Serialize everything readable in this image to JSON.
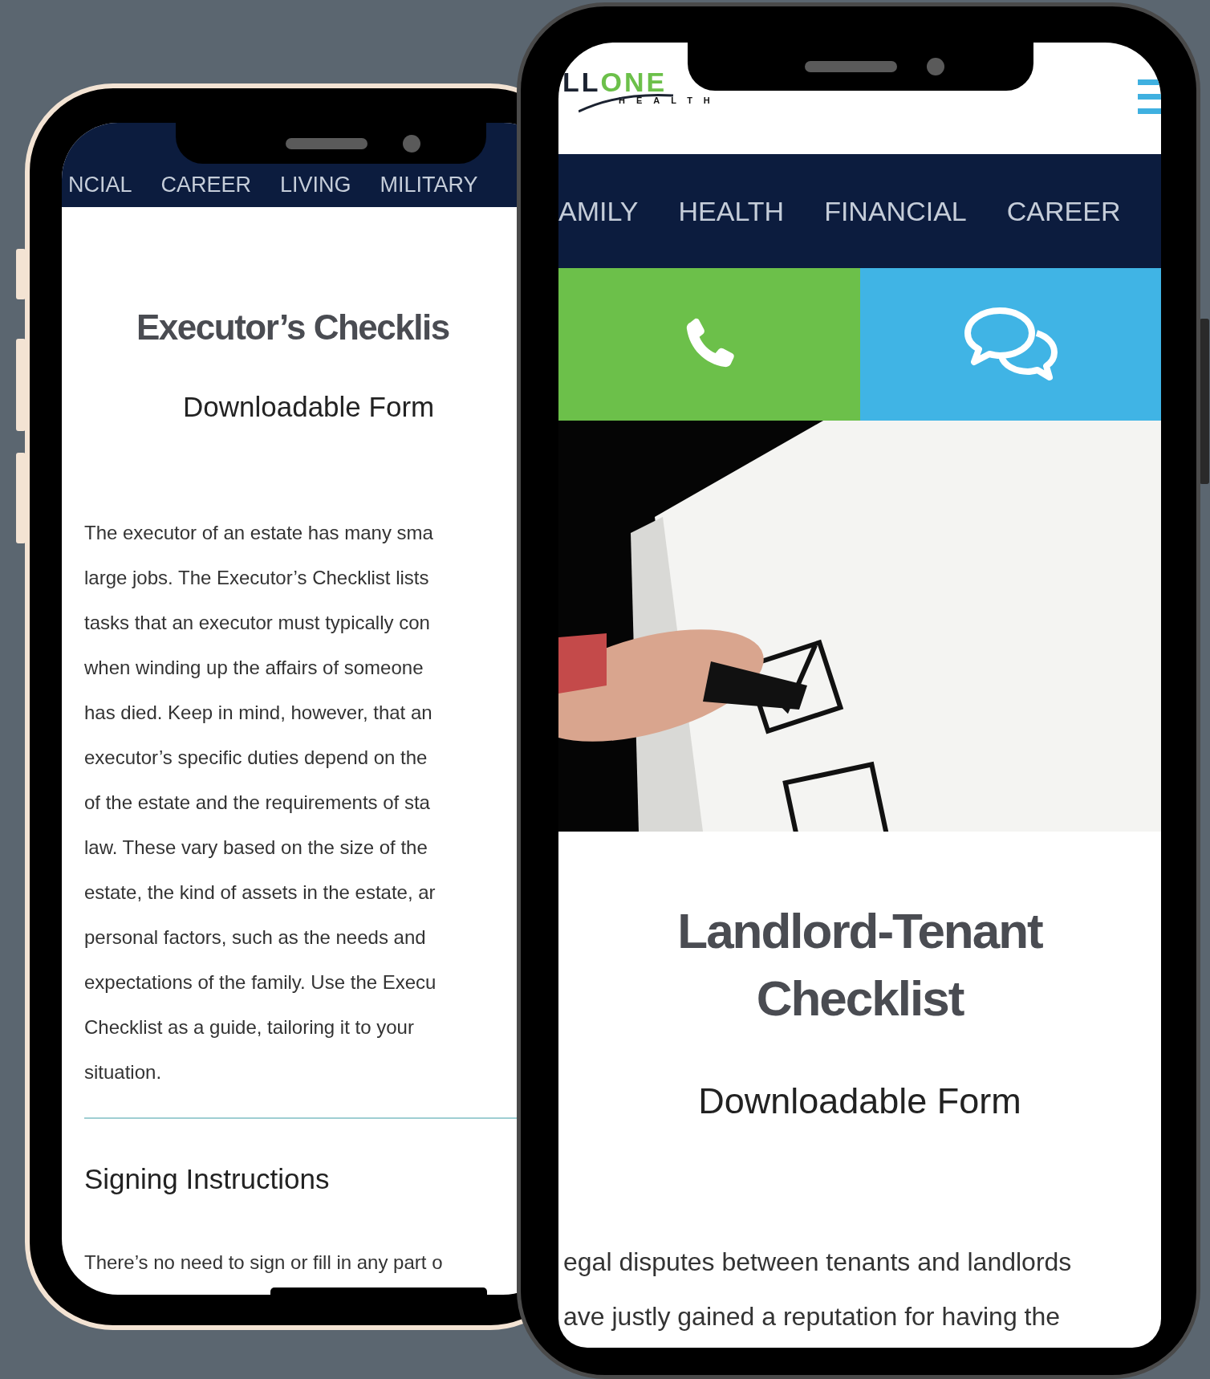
{
  "left_phone": {
    "nav_items": [
      "NCIAL",
      "CAREER",
      "LIVING",
      "MILITARY"
    ],
    "title": "Executor’s Checklis",
    "subtitle": "Downloadable Form",
    "body_lines": [
      "The executor of an estate has many sma",
      "large jobs. The Executor’s Checklist lists",
      "tasks that an executor must typically con",
      "when winding up the affairs of someone",
      "has died. Keep in mind, however, that an",
      "executor’s specific duties depend on the",
      "of the estate and the requirements of sta",
      "law. These vary based on the size of the",
      "estate, the kind of assets in the estate, ar",
      "personal factors, such as the needs and",
      "expectations of the family. Use the Execu",
      "Checklist as a guide, tailoring it to your",
      "situation."
    ],
    "section_heading": "Signing Instructions",
    "section_text": "There’s no need to sign or fill in any part o"
  },
  "right_phone": {
    "logo": {
      "name": "LLONE",
      "tagline": "HEALTH"
    },
    "nav_items": [
      "AMILY",
      "HEALTH",
      "FINANCIAL",
      "CAREER"
    ],
    "actions": [
      {
        "kind": "call",
        "color": "#6cc04a"
      },
      {
        "kind": "chat",
        "color": "#40b4e5"
      }
    ],
    "title_lines": [
      "Landlord-Tenant",
      "Checklist"
    ],
    "subtitle": "Downloadable Form",
    "body_lines": [
      "egal disputes between tenants and landlords",
      "ave justly gained a reputation for having the"
    ]
  }
}
